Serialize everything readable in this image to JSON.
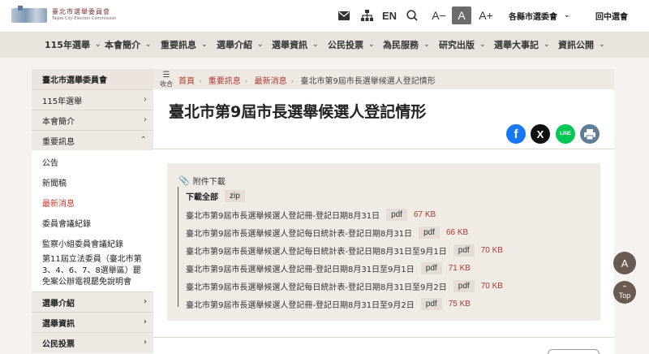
{
  "header": {
    "logo_text": "臺北市選舉委員會",
    "logo_subtext": "Taipei City Election Commission",
    "lang_label": "EN",
    "font_small": "A−",
    "font_medium": "A",
    "font_large": "A+",
    "county_label": "各縣市選委會",
    "back_label": "回中選會"
  },
  "nav": [
    {
      "label": "115年選舉"
    },
    {
      "label": "本會簡介"
    },
    {
      "label": "重要訊息"
    },
    {
      "label": "選舉介紹"
    },
    {
      "label": "選舉資訊"
    },
    {
      "label": "公民投票"
    },
    {
      "label": "為民服務"
    },
    {
      "label": "研究出版"
    },
    {
      "label": "選舉大事記"
    },
    {
      "label": "資訊公開"
    }
  ],
  "sidebar": {
    "head": "臺北市選舉委員會",
    "items": [
      {
        "label": "115年選舉"
      },
      {
        "label": "本會簡介"
      },
      {
        "label": "重要訊息"
      }
    ],
    "sub": [
      {
        "label": "公告"
      },
      {
        "label": "新聞稿"
      },
      {
        "label": "最新消息"
      },
      {
        "label": "委員會議紀錄"
      },
      {
        "label": "監察小組委員會議紀錄"
      },
      {
        "label": "第11屆立法委員（臺北市第3、4、6、7、8選舉區）罷免案公辦電視罷免說明會"
      }
    ],
    "bottom_items": [
      {
        "label": "選舉介紹"
      },
      {
        "label": "選舉資訊"
      },
      {
        "label": "公民投票"
      }
    ]
  },
  "breadcrumb": {
    "collapse_label": "收合",
    "items": [
      "首頁",
      "重要訊息",
      "最新消息"
    ],
    "current": "臺北市第9屆市長選舉候選人登記情形"
  },
  "page": {
    "title": "臺北市第9屆市長選舉候選人登記情形"
  },
  "share": {
    "facebook": "f",
    "x": "X",
    "line": "LINE"
  },
  "attachments": {
    "title": "附件下載",
    "download_all": "下載全部",
    "download_all_format": "zip",
    "files": [
      {
        "name": "臺北市第9屆市長選舉候選人登記冊-登記日期8月31日",
        "format": "pdf",
        "size": "67 KB"
      },
      {
        "name": "臺北市第9屆市長選舉候選人登記每日統計表-登記日期8月31日",
        "format": "pdf",
        "size": "66 KB"
      },
      {
        "name": "臺北市第9屆市長選舉候選人登記每日統計表-登記日期8月31日至9月1日",
        "format": "pdf",
        "size": "70 KB"
      },
      {
        "name": "臺北市第9屆市長選舉候選人登記冊-登記日期8月31日至9月1日",
        "format": "pdf",
        "size": "71 KB"
      },
      {
        "name": "臺北市第9屆市長選舉候選人登記每日統計表-登記日期8月31日至9月2日",
        "format": "pdf",
        "size": "70 KB"
      },
      {
        "name": "臺北市第9屆市長選舉候選人登記冊-登記日期8月31日至9月2日",
        "format": "pdf",
        "size": "75 KB"
      }
    ]
  },
  "floating": {
    "font_button": "A",
    "top_button": "Top"
  }
}
